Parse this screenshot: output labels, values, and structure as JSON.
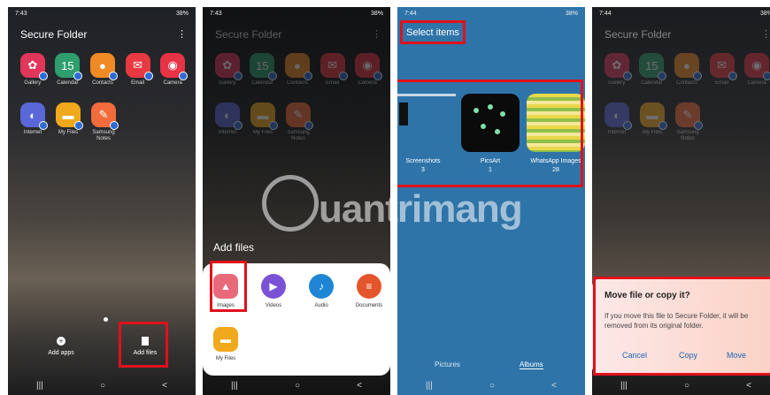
{
  "p1": {
    "time": "7:43",
    "battery": "38%",
    "title": "Secure Folder",
    "apps": [
      {
        "label": "Gallery",
        "color": "#e0365a",
        "glyph": "✿"
      },
      {
        "label": "Calendar",
        "color": "#2e9e6e",
        "glyph": "15"
      },
      {
        "label": "Contacts",
        "color": "#f08a24",
        "glyph": "●"
      },
      {
        "label": "Email",
        "color": "#e63940",
        "glyph": "✉"
      },
      {
        "label": "Camera",
        "color": "#e63345",
        "glyph": "◉"
      }
    ],
    "apps2": [
      {
        "label": "Internet",
        "color": "#5a67d8",
        "glyph": "◐"
      },
      {
        "label": "My Files",
        "color": "#f0a81c",
        "glyph": "▬"
      },
      {
        "label": "Samsung Notes",
        "color": "#f26b3a",
        "glyph": "✎"
      }
    ],
    "add_apps": "Add apps",
    "add_files": "Add files"
  },
  "p2": {
    "time": "7:43",
    "title": "Secure Folder",
    "add_files_heading": "Add files",
    "apps": [
      {
        "label": "Gallery"
      },
      {
        "label": "Calendar"
      },
      {
        "label": "Contacts"
      },
      {
        "label": "Email"
      },
      {
        "label": "Camera"
      }
    ],
    "apps2": [
      {
        "label": "Internet"
      },
      {
        "label": "My Files"
      },
      {
        "label": "Samsung Notes"
      }
    ],
    "sheet": [
      {
        "label": "Images",
        "color": "#e86a7a",
        "glyph": "▲"
      },
      {
        "label": "Videos",
        "color": "#7a52d6",
        "glyph": "▶"
      },
      {
        "label": "Audio",
        "color": "#1f86d6",
        "glyph": "♪"
      },
      {
        "label": "Documents",
        "color": "#e4552c",
        "glyph": "≡"
      }
    ],
    "sheet2": [
      {
        "label": "My Files",
        "color": "#f0a81c",
        "glyph": "▬"
      }
    ]
  },
  "p3": {
    "time": "7:44",
    "battery": "38%",
    "title": "Select items",
    "albums": [
      {
        "name": "Screenshots",
        "count": "3"
      },
      {
        "name": "PicsArt",
        "count": "1"
      },
      {
        "name": "WhatsApp Images",
        "count": "28"
      }
    ],
    "tabs": {
      "pictures": "Pictures",
      "albums": "Albums"
    }
  },
  "p4": {
    "time": "7:44",
    "battery": "38%",
    "title": "Secure Folder",
    "dialog": {
      "title": "Move file or copy it?",
      "body": "If you move this file to Secure Folder, it will be removed from its original folder.",
      "cancel": "Cancel",
      "copy": "Copy",
      "move": "Move"
    }
  },
  "watermark": "uantrimang",
  "nav": {
    "recents": "|||",
    "home": "○",
    "back": "<"
  }
}
